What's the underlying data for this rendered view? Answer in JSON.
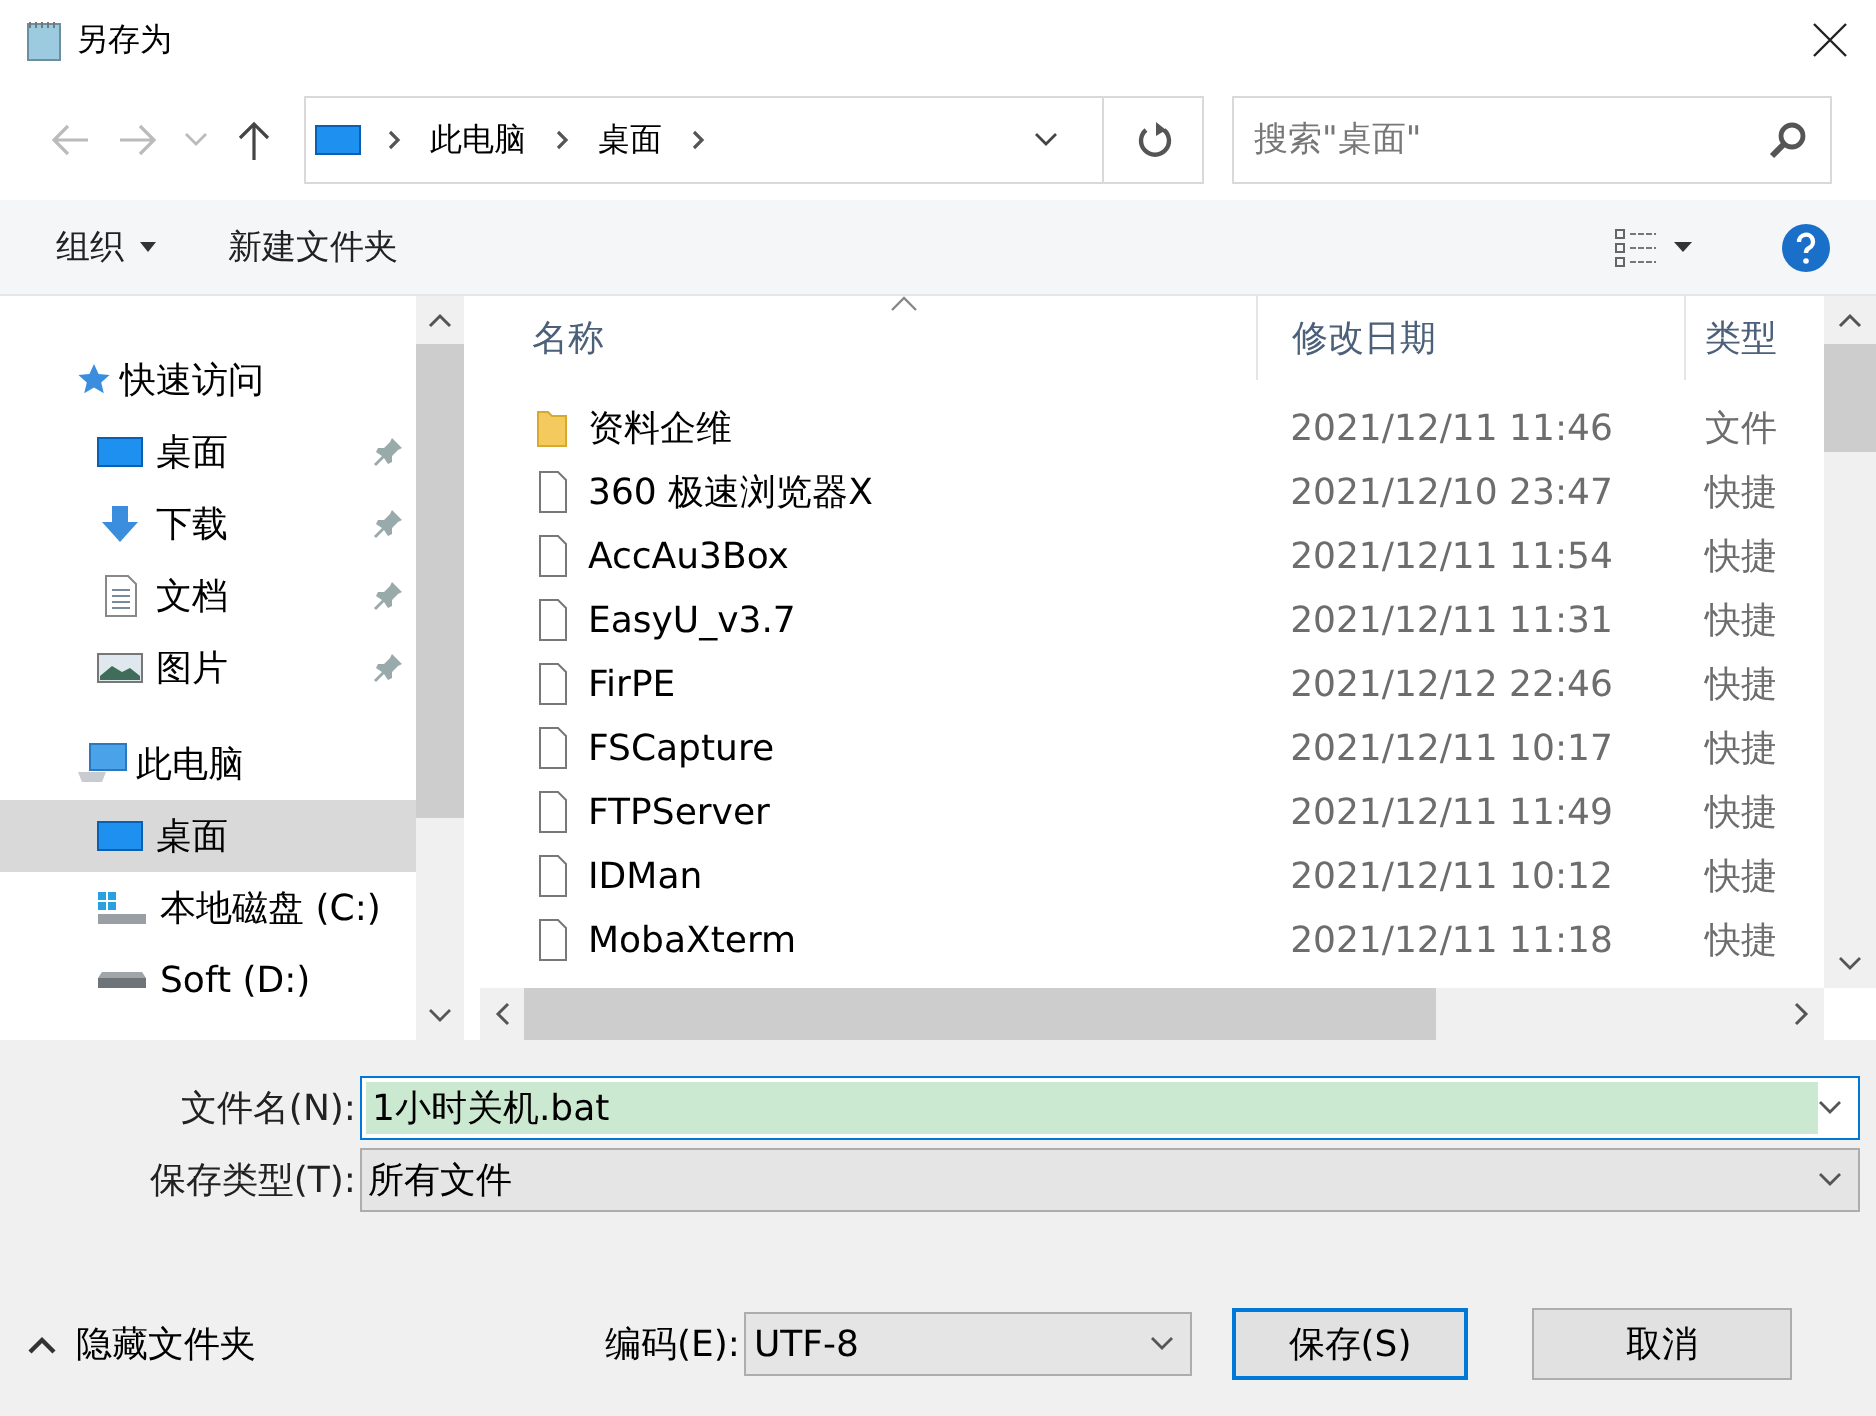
{
  "window": {
    "title": "另存为"
  },
  "address": {
    "path": [
      {
        "label": "此电脑"
      },
      {
        "label": "桌面"
      }
    ]
  },
  "search": {
    "placeholder": "搜索\"桌面\""
  },
  "toolbar": {
    "organize": "组织",
    "new_folder": "新建文件夹"
  },
  "sidebar": {
    "items": [
      {
        "kind": "section",
        "label": "快速访问",
        "selected": false,
        "children": [
          {
            "kind": "item",
            "label": "桌面",
            "pinned": true,
            "selected": false
          },
          {
            "kind": "item",
            "label": "下载",
            "pinned": true,
            "selected": false
          },
          {
            "kind": "item",
            "label": "文档",
            "pinned": true,
            "selected": false
          },
          {
            "kind": "item",
            "label": "图片",
            "pinned": true,
            "selected": false
          }
        ]
      },
      {
        "kind": "section",
        "label": "此电脑",
        "selected": false,
        "children": [
          {
            "kind": "item",
            "label": "桌面",
            "pinned": false,
            "selected": true
          },
          {
            "kind": "item",
            "label": "本地磁盘 (C:)",
            "pinned": false,
            "selected": false
          },
          {
            "kind": "item",
            "label": "Soft (D:)",
            "pinned": false,
            "selected": false
          }
        ]
      }
    ]
  },
  "table": {
    "columns": [
      "名称",
      "修改日期",
      "类型"
    ],
    "rows": [
      {
        "kind": "folder",
        "name": "资料企维",
        "date": "2021/12/11 11:46",
        "type": "文件"
      },
      {
        "kind": "shortcut",
        "name": "360 极速浏览器X",
        "date": "2021/12/10 23:47",
        "type": "快捷"
      },
      {
        "kind": "shortcut",
        "name": "AccAu3Box",
        "date": "2021/12/11 11:54",
        "type": "快捷"
      },
      {
        "kind": "shortcut",
        "name": "EasyU_v3.7",
        "date": "2021/12/11 11:31",
        "type": "快捷"
      },
      {
        "kind": "shortcut",
        "name": "FirPE",
        "date": "2021/12/12 22:46",
        "type": "快捷"
      },
      {
        "kind": "shortcut",
        "name": "FSCapture",
        "date": "2021/12/11 10:17",
        "type": "快捷"
      },
      {
        "kind": "shortcut",
        "name": "FTPServer",
        "date": "2021/12/11 11:49",
        "type": "快捷"
      },
      {
        "kind": "shortcut",
        "name": "IDMan",
        "date": "2021/12/11 10:12",
        "type": "快捷"
      },
      {
        "kind": "shortcut",
        "name": "MobaXterm",
        "date": "2021/12/11 11:18",
        "type": "快捷"
      }
    ]
  },
  "form": {
    "filename_label": "文件名(N):",
    "filename": "1小时关机.bat",
    "filetype_label": "保存类型(T):",
    "filetype": "所有文件"
  },
  "footer": {
    "hide_folders": "隐藏文件夹",
    "encoding_label": "编码(E):",
    "encoding": "UTF-8",
    "save": "保存(S)",
    "cancel": "取消"
  }
}
